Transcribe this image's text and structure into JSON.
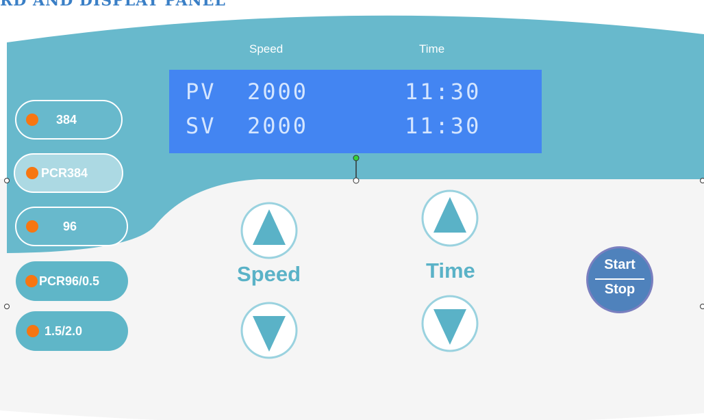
{
  "heading": "RD AND DISPLAY PANEL",
  "display": {
    "speed_label": "Speed",
    "time_label": "Time",
    "rows": [
      {
        "label": "PV",
        "speed": "2000",
        "time": "11:30"
      },
      {
        "label": "SV",
        "speed": "2000",
        "time": "11:30"
      }
    ]
  },
  "modes": [
    {
      "label": "384"
    },
    {
      "label": "PCR384"
    },
    {
      "label": "96"
    },
    {
      "label": "PCR96/0.5"
    },
    {
      "label": "1.5/2.0"
    }
  ],
  "controls": {
    "speed_label": "Speed",
    "time_label": "Time"
  },
  "start_stop": {
    "top": "Start",
    "bottom": "Stop"
  },
  "colors": {
    "panel_teal": "#68b9cc",
    "panel_light": "#f5f5f5",
    "lcd_blue": "#4385f2",
    "indicator_orange": "#f77611",
    "start_button": "#4f82bc"
  }
}
